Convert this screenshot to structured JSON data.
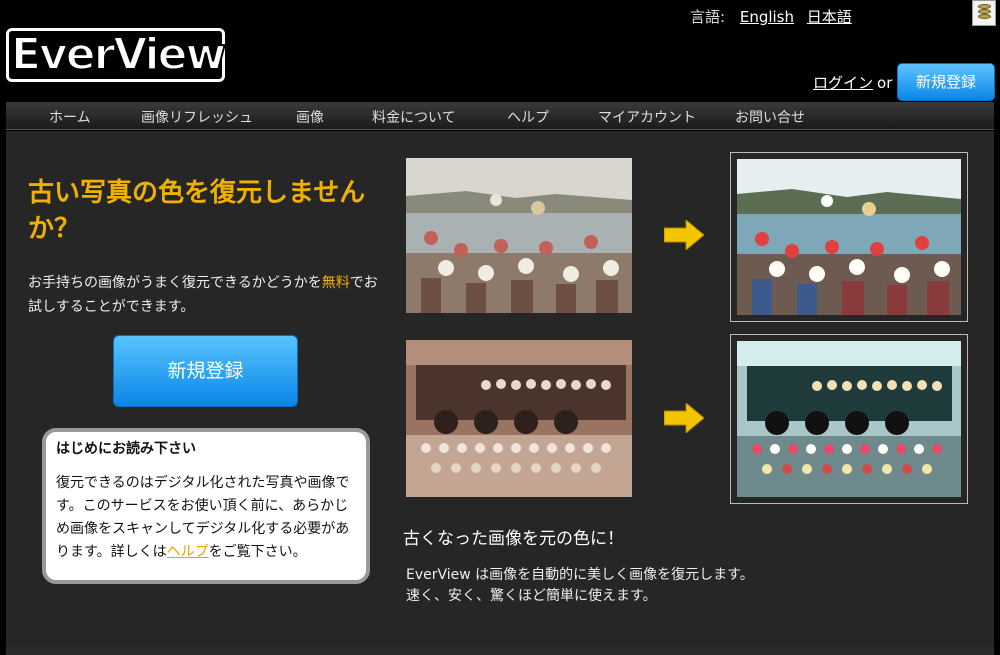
{
  "header": {
    "logo_text": "EverView",
    "language_label": "言語:",
    "languages": [
      "English",
      "日本語"
    ],
    "login_label": "ログイン",
    "or_label": "or",
    "signup_label": "新規登録"
  },
  "nav": {
    "items": [
      "ホーム",
      "画像リフレッシュ",
      "画像",
      "料金について",
      "ヘルプ",
      "マイアカウント",
      "お問い合せ"
    ]
  },
  "hero": {
    "headline": "古い写真の色を復元しませんか？",
    "lead_before": "お手持ちの画像がうまく復元できるかどうかを",
    "lead_free": "無料",
    "lead_after": "でお試しすることができます。",
    "cta_label": "新規登録"
  },
  "notice": {
    "title": "はじめにお読み下さい",
    "body_before": "復元できるのはデジタル化された写真や画像です。このサービスをお使い頂く前に、あらかじめ画像をスキャンしてデジタル化する必要があります。詳しくは",
    "help_link": "ヘルプ",
    "body_after": "をご覧下さい。"
  },
  "showcase": {
    "caption": "古くなった画像を元の色に！",
    "description_line1": "EverView は画像を自動的に美しく画像を復元します。",
    "description_line2": "速く、安く、驚くほど簡単に使えます。"
  },
  "colors": {
    "accent": "#f0b000",
    "button_blue": "#0a86e6",
    "background": "#000000",
    "panel": "#262626"
  }
}
